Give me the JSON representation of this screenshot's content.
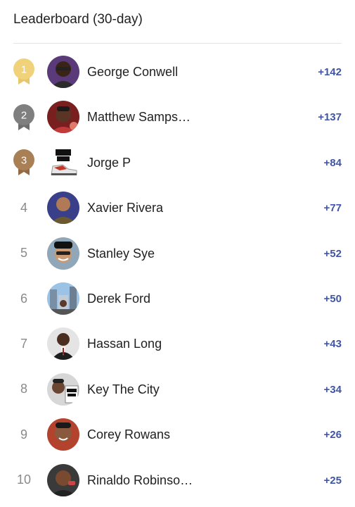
{
  "header": {
    "title": "Leaderboard (30-day)"
  },
  "colors": {
    "gold": "#f0d27a",
    "silver": "#7f7f7f",
    "bronze": "#a97f56",
    "score": "#3f55a5"
  },
  "entries": [
    {
      "rank": "1",
      "name": "George Conwell",
      "score": "+142",
      "medal": "gold"
    },
    {
      "rank": "2",
      "name": "Matthew Samps…",
      "score": "+137",
      "medal": "silver"
    },
    {
      "rank": "3",
      "name": "Jorge P",
      "score": "+84",
      "medal": "bronze"
    },
    {
      "rank": "4",
      "name": "Xavier Rivera",
      "score": "+77"
    },
    {
      "rank": "5",
      "name": "Stanley Sye",
      "score": "+52"
    },
    {
      "rank": "6",
      "name": "Derek Ford",
      "score": "+50"
    },
    {
      "rank": "7",
      "name": "Hassan Long",
      "score": "+43"
    },
    {
      "rank": "8",
      "name": "Key The City",
      "score": "+34"
    },
    {
      "rank": "9",
      "name": "Corey Rowans",
      "score": "+26"
    },
    {
      "rank": "10",
      "name": "Rinaldo Robinso…",
      "score": "+25"
    }
  ]
}
